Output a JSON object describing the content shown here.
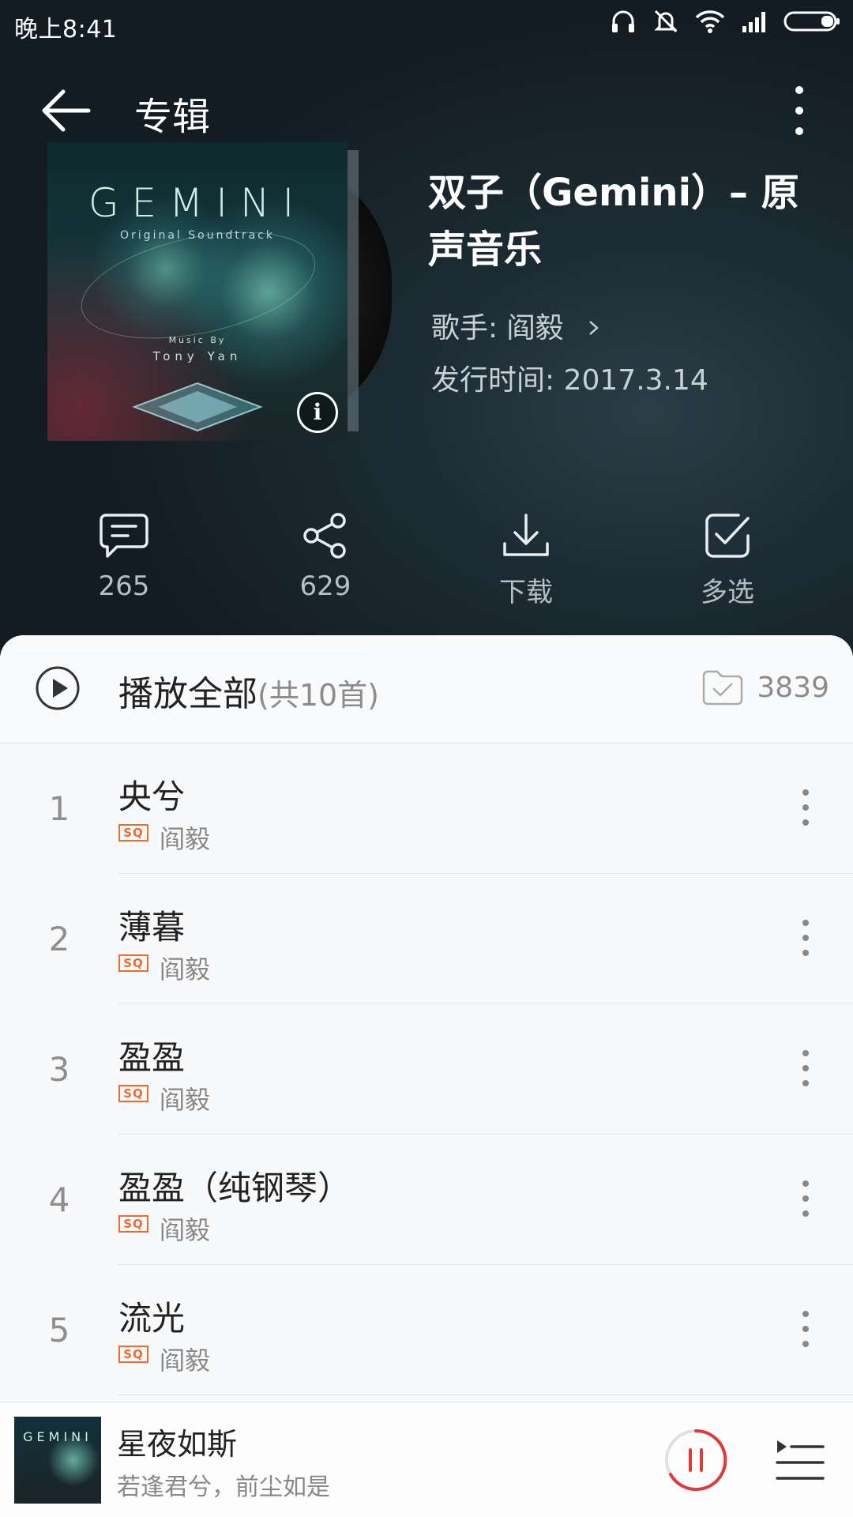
{
  "status_bar": {
    "time": "晚上8:41"
  },
  "header": {
    "title": "专辑"
  },
  "album": {
    "title": "双子（Gemini）– 原声音乐",
    "artist_label": "歌手: 阎毅",
    "release_label": "发行时间: 2017.3.14",
    "cover_text": {
      "title": "GEMINI",
      "subtitle": "Original Soundtrack",
      "music_by": "Music By",
      "composer": "Tony Yan"
    }
  },
  "actions": {
    "comment_count": "265",
    "share_count": "629",
    "download_label": "下载",
    "multiselect_label": "多选"
  },
  "playlist": {
    "play_all_label": "播放全部",
    "total_label": "(共10首)",
    "collect_count": "3839",
    "tracks": [
      {
        "index": "1",
        "name": "央兮",
        "quality": "SQ",
        "artist": "阎毅"
      },
      {
        "index": "2",
        "name": "薄暮",
        "quality": "SQ",
        "artist": "阎毅"
      },
      {
        "index": "3",
        "name": "盈盈",
        "quality": "SQ",
        "artist": "阎毅"
      },
      {
        "index": "4",
        "name": "盈盈（纯钢琴）",
        "quality": "SQ",
        "artist": "阎毅"
      },
      {
        "index": "5",
        "name": "流光",
        "quality": "SQ",
        "artist": "阎毅"
      }
    ]
  },
  "mini_player": {
    "song": "星夜如斯",
    "lyric": "若逢君兮，前尘如是",
    "art_text": "GEMINI"
  },
  "colors": {
    "accent": "#e03a3a",
    "sq_badge": "#f06a2f",
    "header_bg": "#1c2b33"
  }
}
